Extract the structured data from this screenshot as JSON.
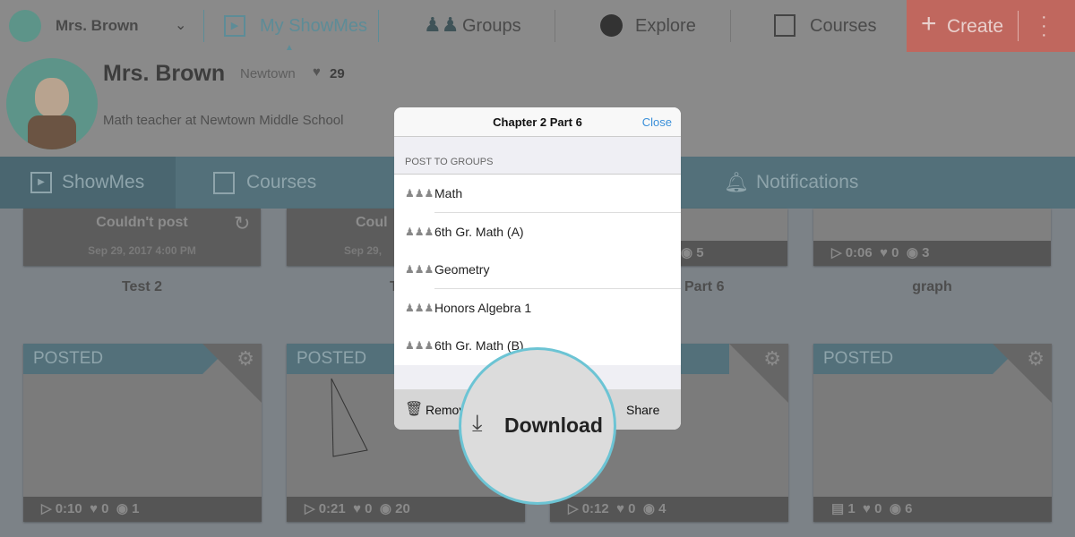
{
  "topnav": {
    "user": "Mrs. Brown",
    "items": [
      {
        "label": "My ShowMes",
        "active": true
      },
      {
        "label": "Groups"
      },
      {
        "label": "Explore"
      },
      {
        "label": "Courses"
      }
    ],
    "create": "Create"
  },
  "profile": {
    "name": "Mrs. Brown",
    "location": "Newtown",
    "likes": "29",
    "bio": "Math teacher at Newtown Middle School"
  },
  "tabs": [
    {
      "label": "ShowMes",
      "active": true
    },
    {
      "label": "Courses"
    },
    {
      "label": "Notifications"
    }
  ],
  "row1": [
    {
      "status": "Couldn't post",
      "date": "Sep 29, 2017 4:00 PM",
      "title": "Test 2"
    },
    {
      "status": "Coul",
      "date": "Sep 29, ",
      "title": "T"
    },
    {
      "views": "5",
      "title": "Part 6"
    },
    {
      "duration": "0:06",
      "likes": "0",
      "views": "3",
      "title": "graph"
    }
  ],
  "row2": [
    {
      "badge": "POSTED",
      "duration": "0:10",
      "likes": "0",
      "views": "1"
    },
    {
      "badge": "POSTED",
      "duration": "0:21",
      "likes": "0",
      "views": "20"
    },
    {
      "badge": "POSTED",
      "duration": "0:12",
      "likes": "0",
      "views": "4"
    },
    {
      "badge": "POSTED",
      "pages": "1",
      "likes": "0",
      "views": "6"
    }
  ],
  "modal": {
    "title": "Chapter 2 Part 6",
    "close": "Close",
    "section": "POST TO GROUPS",
    "groups": [
      "Math",
      "6th Gr. Math (A)",
      "Geometry",
      "Honors Algebra 1",
      "6th Gr. Math (B)"
    ],
    "remove": "Remove",
    "share": "Share",
    "download": "Download"
  },
  "colors": {
    "accent": "#6cc4d4",
    "create": "#e0675b",
    "tab_bar": "#3e8a9f"
  }
}
